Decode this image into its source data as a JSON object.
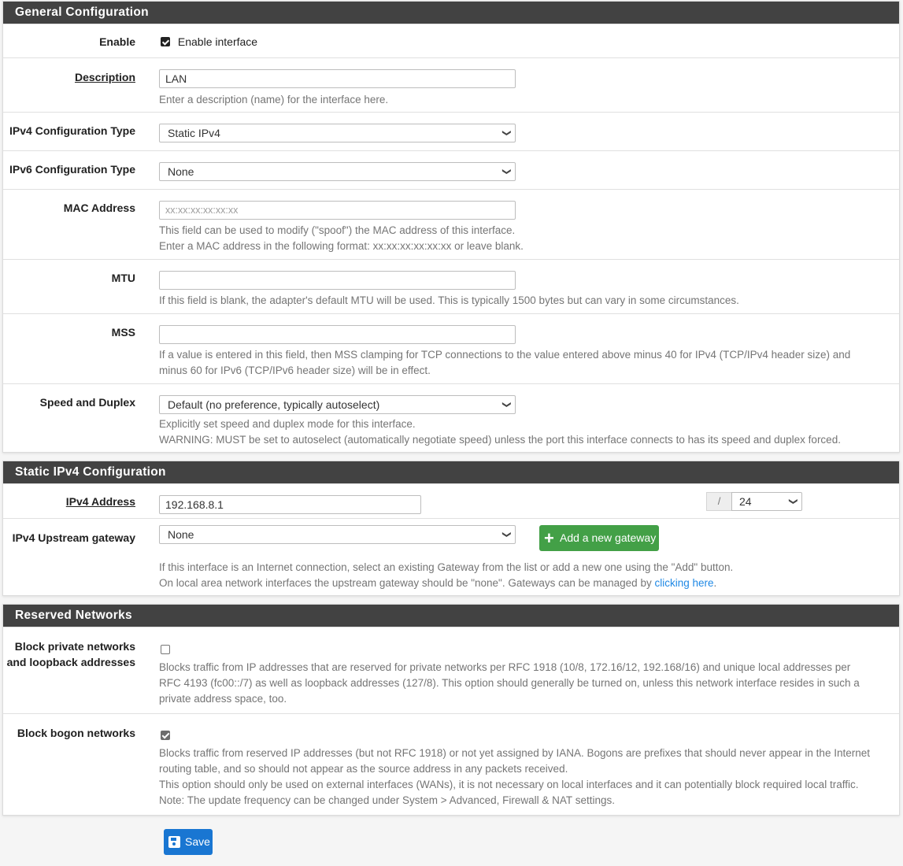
{
  "general": {
    "title": "General Configuration",
    "enable": {
      "label": "Enable",
      "checkbox_label": "Enable interface",
      "checked": true
    },
    "description": {
      "label": "Description",
      "value": "LAN",
      "help": "Enter a description (name) for the interface here."
    },
    "ipv4_type": {
      "label": "IPv4 Configuration Type",
      "value": "Static IPv4"
    },
    "ipv6_type": {
      "label": "IPv6 Configuration Type",
      "value": "None"
    },
    "mac": {
      "label": "MAC Address",
      "placeholder": "xx:xx:xx:xx:xx:xx",
      "help1": "This field can be used to modify (\"spoof\") the MAC address of this interface.",
      "help2": "Enter a MAC address in the following format: xx:xx:xx:xx:xx:xx or leave blank."
    },
    "mtu": {
      "label": "MTU",
      "value": "",
      "help": "If this field is blank, the adapter's default MTU will be used. This is typically 1500 bytes but can vary in some circumstances."
    },
    "mss": {
      "label": "MSS",
      "value": "",
      "help1": "If a value is entered in this field, then MSS clamping for TCP connections to the value entered above minus 40 for IPv4 (TCP/IPv4 header size) and",
      "help2": "minus 60 for IPv6 (TCP/IPv6 header size) will be in effect."
    },
    "speed": {
      "label": "Speed and Duplex",
      "value": "Default (no preference, typically autoselect)",
      "help1": "Explicitly set speed and duplex mode for this interface.",
      "help2": "WARNING: MUST be set to autoselect (automatically negotiate speed) unless the port this interface connects to has its speed and duplex forced."
    }
  },
  "static_ipv4": {
    "title": "Static IPv4 Configuration",
    "address": {
      "label": "IPv4 Address",
      "value": "192.168.8.1",
      "separator": "/",
      "cidr": "24"
    },
    "gateway": {
      "label": "IPv4 Upstream gateway",
      "value": "None",
      "add_button": "Add a new gateway",
      "help1": "If this interface is an Internet connection, select an existing Gateway from the list or add a new one using the \"Add\" button.",
      "help2_prefix": "On local area network interfaces the upstream gateway should be \"none\". Gateways can be managed by ",
      "help2_link": "clicking here",
      "help2_suffix": "."
    }
  },
  "reserved": {
    "title": "Reserved Networks",
    "private": {
      "label_line1": "Block private networks",
      "label_line2": "and loopback addresses",
      "checked": false,
      "help1": "Blocks traffic from IP addresses that are reserved for private networks per RFC 1918 (10/8, 172.16/12, 192.168/16) and unique local addresses per",
      "help2": "RFC 4193 (fc00::/7) as well as loopback addresses (127/8). This option should generally be turned on, unless this network interface resides in such a",
      "help3": "private address space, too."
    },
    "bogon": {
      "label": "Block bogon networks",
      "checked": true,
      "help1": "Blocks traffic from reserved IP addresses (but not RFC 1918) or not yet assigned by IANA. Bogons are prefixes that should never appear in the Internet",
      "help2": "routing table, and so should not appear as the source address in any packets received.",
      "help3": "This option should only be used on external interfaces (WANs), it is not necessary on local interfaces and it can potentially block required local traffic.",
      "help4": "Note: The update frequency can be changed under System > Advanced, Firewall & NAT settings."
    }
  },
  "actions": {
    "save": "Save"
  },
  "colors": {
    "header_bg": "#424242",
    "green_button": "#43a047",
    "save_button": "#1976d2",
    "link": "#1e88e5"
  }
}
